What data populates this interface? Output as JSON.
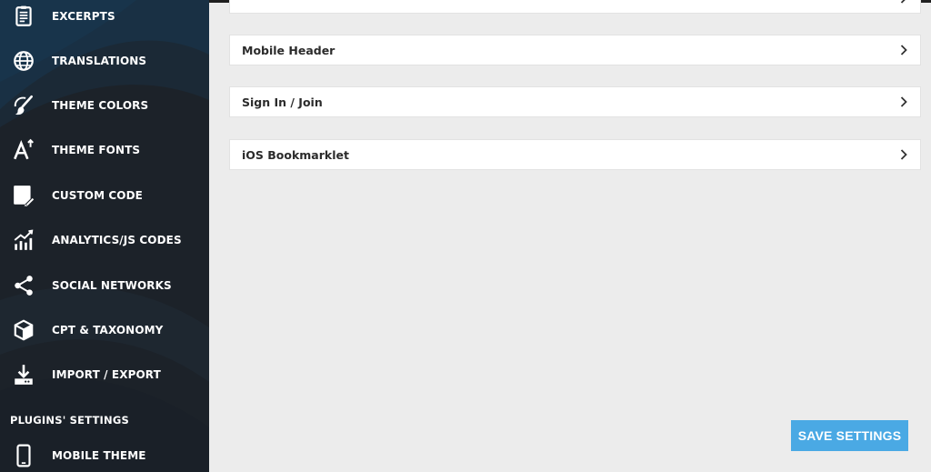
{
  "sidebar": {
    "items": [
      {
        "label": "EXCERPTS",
        "icon": "excerpts-icon"
      },
      {
        "label": "TRANSLATIONS",
        "icon": "globe-icon"
      },
      {
        "label": "THEME COLORS",
        "icon": "paint-icon"
      },
      {
        "label": "THEME FONTS",
        "icon": "font-icon"
      },
      {
        "label": "CUSTOM CODE",
        "icon": "code-edit-icon"
      },
      {
        "label": "ANALYTICS/JS CODES",
        "icon": "analytics-icon"
      },
      {
        "label": "SOCIAL NETWORKS",
        "icon": "share-icon"
      },
      {
        "label": "CPT & TAXONOMY",
        "icon": "box-icon"
      },
      {
        "label": "IMPORT / EXPORT",
        "icon": "download-icon"
      }
    ],
    "section_heading": "PLUGINS' SETTINGS",
    "plugin_items": [
      {
        "label": "MOBILE THEME",
        "icon": "mobile-icon"
      }
    ]
  },
  "main": {
    "panels": [
      {
        "label": ""
      },
      {
        "label": "Mobile Header"
      },
      {
        "label": "Sign In / Join"
      },
      {
        "label": "iOS Bookmarklet"
      }
    ],
    "save_label": "SAVE SETTINGS"
  },
  "colors": {
    "sidebar_bg": "#1c2229",
    "accent": "#4aa9e4",
    "content_bg": "#ececec"
  }
}
